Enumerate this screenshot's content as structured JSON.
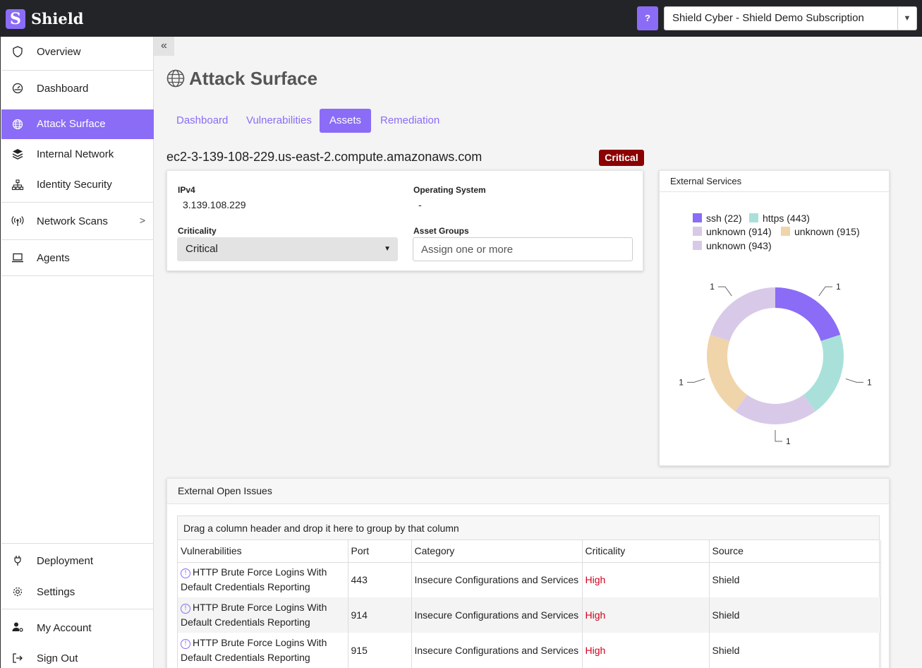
{
  "header": {
    "logo_letter": "S",
    "brand": "Shield",
    "help_label": "?",
    "subscription": "Shield Cyber - Shield Demo Subscription"
  },
  "sidebar": {
    "items": [
      {
        "label": "Overview",
        "icon": "shield-icon"
      },
      {
        "label": "Dashboard",
        "icon": "gauge-icon"
      },
      {
        "label": "Attack Surface",
        "icon": "globe-icon",
        "active": true
      },
      {
        "label": "Internal Network",
        "icon": "layers-icon"
      },
      {
        "label": "Identity Security",
        "icon": "org-chart-icon"
      },
      {
        "label": "Network Scans",
        "icon": "broadcast-icon"
      },
      {
        "label": "Agents",
        "icon": "laptop-icon"
      }
    ],
    "bottom_items": [
      {
        "label": "Deployment",
        "icon": "plug-icon"
      },
      {
        "label": "Settings",
        "icon": "gear-icon"
      },
      {
        "label": "My Account",
        "icon": "user-gear-icon"
      },
      {
        "label": "Sign Out",
        "icon": "sign-out-icon"
      }
    ]
  },
  "page": {
    "title": "Attack Surface",
    "tabs": [
      "Dashboard",
      "Vulnerabilities",
      "Assets",
      "Remediation"
    ],
    "active_tab": "Assets",
    "hostname": "ec2-3-139-108-229.us-east-2.compute.amazonaws.com",
    "criticality_badge": "Critical"
  },
  "asset": {
    "ipv4_label": "IPv4",
    "ipv4": "3.139.108.229",
    "os_label": "Operating System",
    "os": "-",
    "criticality_label": "Criticality",
    "criticality": "Critical",
    "asset_groups_label": "Asset Groups",
    "asset_groups_placeholder": "Assign one or more"
  },
  "services": {
    "title": "External Services",
    "legend": [
      "ssh (22)",
      "https (443)",
      "unknown (914)",
      "unknown (915)",
      "unknown (943)"
    ]
  },
  "chart_data": {
    "type": "pie",
    "donut": true,
    "labels": [
      "ssh (22)",
      "https (443)",
      "unknown (943)",
      "unknown (915)",
      "unknown (914)"
    ],
    "values": [
      1,
      1,
      1,
      1,
      1
    ],
    "colors": [
      "#8b6cf6",
      "#a9e1da",
      "#d9c9e8",
      "#f0d4aa",
      "#d9c9e8"
    ],
    "data_labels": [
      "1",
      "1",
      "1",
      "1",
      "1"
    ],
    "legend_position": "top"
  },
  "issues": {
    "title": "External Open Issues",
    "group_hint": "Drag a column header and drop it here to group by that column",
    "columns": [
      "Vulnerabilities",
      "Port",
      "Category",
      "Criticality",
      "Source"
    ],
    "rows": [
      {
        "vuln": "HTTP Brute Force Logins With Default Credentials Reporting",
        "port": "443",
        "category": "Insecure Configurations and Services",
        "criticality": "High",
        "source": "Shield"
      },
      {
        "vuln": "HTTP Brute Force Logins With Default Credentials Reporting",
        "port": "914",
        "category": "Insecure Configurations and Services",
        "criticality": "High",
        "source": "Shield"
      },
      {
        "vuln": "HTTP Brute Force Logins With Default Credentials Reporting",
        "port": "915",
        "category": "Insecure Configurations and Services",
        "criticality": "High",
        "source": "Shield"
      }
    ]
  }
}
